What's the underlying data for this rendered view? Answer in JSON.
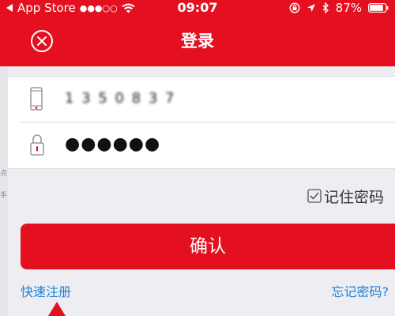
{
  "status_bar": {
    "back_app": "App Store",
    "time": "09:07",
    "battery": "87%"
  },
  "header": {
    "title": "登录"
  },
  "form": {
    "phone_value": "1 3  5    0 8 3 7",
    "password_value": "●●●●●●"
  },
  "remember": {
    "label": "记住密码",
    "checked": true
  },
  "buttons": {
    "confirm_label": "确认"
  },
  "links": {
    "register": "快速注册",
    "forgot": "忘记密码?"
  },
  "background_hint": {
    "char_1": "点",
    "char_2": "手"
  },
  "colors": {
    "brand_red": "#e4101f",
    "link_blue": "#1c7fd7"
  }
}
